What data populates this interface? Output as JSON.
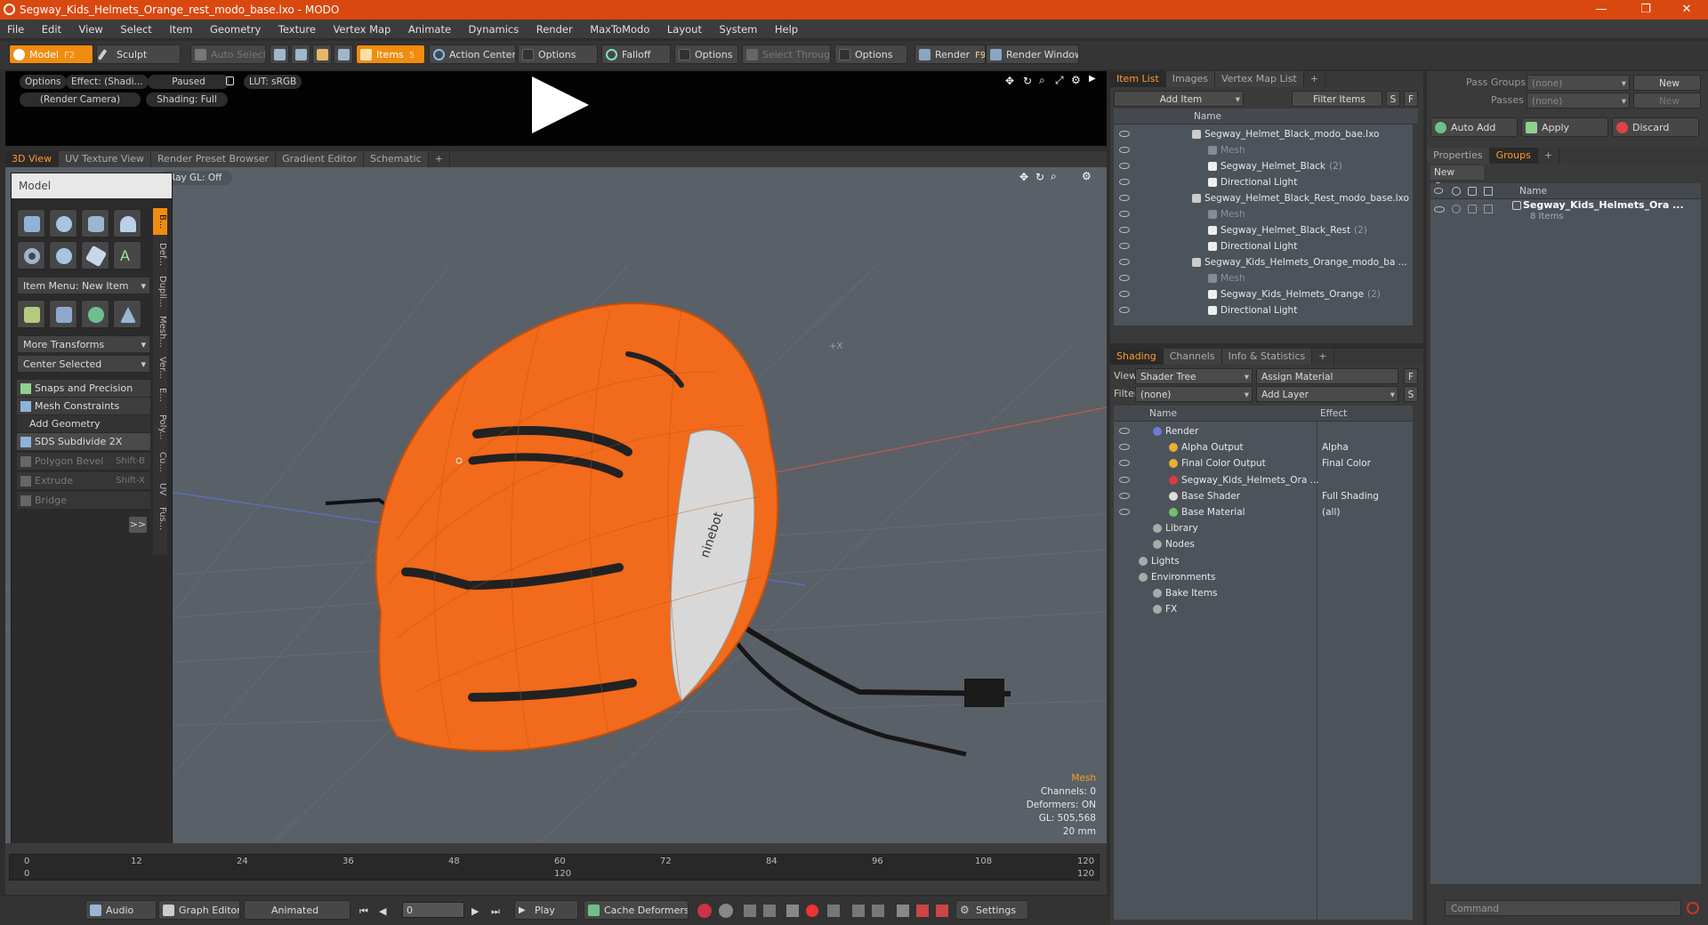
{
  "window": {
    "title": "Segway_Kids_Helmets_Orange_rest_modo_base.lxo - MODO",
    "minimize": "—",
    "maximize": "❐",
    "close": "✕"
  },
  "menu": [
    "File",
    "Edit",
    "View",
    "Select",
    "Item",
    "Geometry",
    "Texture",
    "Vertex Map",
    "Animate",
    "Dynamics",
    "Render",
    "MaxToModo",
    "Layout",
    "System",
    "Help"
  ],
  "toolbar": {
    "model": "Model",
    "model_key": "F2",
    "sculpt": "Sculpt",
    "auto_select": "Auto Select",
    "items": "Items",
    "items_key": "5",
    "action_center": "Action Center",
    "options1": "Options",
    "falloff": "Falloff",
    "options2": "Options",
    "select_through": "Select Through",
    "options3": "Options",
    "render": "Render",
    "render_key": "F9",
    "render_window": "Render Window"
  },
  "preview": {
    "options": "Options",
    "effect": "Effect: (Shadi...",
    "paused": "Paused",
    "lut": "LUT: sRGB",
    "camera": "(Render Camera)",
    "shading": "Shading: Full"
  },
  "view_tabs": [
    "3D View",
    "UV Texture View",
    "Render Preset Browser",
    "Gradient Editor",
    "Schematic",
    "+"
  ],
  "viewport": {
    "raygl": "Ray GL: Off",
    "axis_label": "+X",
    "stats": {
      "mode": "Mesh",
      "channels": "Channels: 0",
      "deformers": "Deformers: ON",
      "gl": "GL: 505,568",
      "scale": "20 mm"
    }
  },
  "toolpanel": {
    "title": "Model",
    "item_menu": "Item Menu: New Item",
    "more_transforms": "More Transforms",
    "center_selected": "Center Selected",
    "snaps": "Snaps and Precision",
    "mesh_constraints": "Mesh Constraints",
    "add_geometry": "Add Geometry",
    "sds": "SDS Subdivide 2X",
    "polygon_bevel": "Polygon Bevel",
    "polygon_bevel_key": "Shift-B",
    "extrude": "Extrude",
    "extrude_key": "Shift-X",
    "bridge": "Bridge",
    "more": ">>",
    "vtabs": [
      "B...",
      "Def...",
      "Dupli...",
      "Mesh...",
      "Ver...",
      "E...",
      "Poly...",
      "Cu...",
      "UV",
      "Fus..."
    ]
  },
  "timeline": {
    "ticks": [
      "0",
      "12",
      "24",
      "36",
      "48",
      "60",
      "72",
      "84",
      "96",
      "108",
      "120"
    ],
    "sub": [
      "0",
      "120",
      "120"
    ]
  },
  "transport": {
    "audio": "Audio",
    "graph_editor": "Graph Editor",
    "animated": "Animated",
    "frame": "0",
    "play": "Play",
    "cache": "Cache Deformers",
    "settings": "Settings"
  },
  "item_list": {
    "tabs": [
      "Item List",
      "Images",
      "Vertex Map List",
      "+"
    ],
    "add_item": "Add Item",
    "filter": "Filter Items",
    "s": "S",
    "f": "F",
    "col_name": "Name",
    "rows": [
      {
        "label": "Segway_Helmet_Black_modo_bae.lxo",
        "count": "",
        "dim": false
      },
      {
        "label": "Mesh",
        "count": "",
        "dim": true
      },
      {
        "label": "Segway_Helmet_Black",
        "count": "(2)",
        "dim": false
      },
      {
        "label": "Directional Light",
        "count": "",
        "dim": false
      },
      {
        "label": "Segway_Helmet_Black_Rest_modo_base.lxo",
        "count": "",
        "dim": false
      },
      {
        "label": "Mesh",
        "count": "",
        "dim": true
      },
      {
        "label": "Segway_Helmet_Black_Rest",
        "count": "(2)",
        "dim": false
      },
      {
        "label": "Directional Light",
        "count": "",
        "dim": false
      },
      {
        "label": "Segway_Kids_Helmets_Orange_modo_ba ...",
        "count": "",
        "dim": false
      },
      {
        "label": "Mesh",
        "count": "",
        "dim": true
      },
      {
        "label": "Segway_Kids_Helmets_Orange",
        "count": "(2)",
        "dim": false
      },
      {
        "label": "Directional Light",
        "count": "",
        "dim": false
      }
    ]
  },
  "shading": {
    "tabs": [
      "Shading",
      "Channels",
      "Info & Statistics",
      "+"
    ],
    "view_label": "View",
    "view_value": "Shader Tree",
    "assign": "Assign Material",
    "filter_label": "Filter",
    "filter_value": "(none)",
    "add_layer": "Add Layer",
    "f": "F",
    "s": "S",
    "col_name": "Name",
    "col_effect": "Effect",
    "rows": [
      {
        "label": "Render",
        "effect": ""
      },
      {
        "label": "Alpha Output",
        "effect": "Alpha"
      },
      {
        "label": "Final Color Output",
        "effect": "Final Color"
      },
      {
        "label": "Segway_Kids_Helmets_Ora ...",
        "effect": ""
      },
      {
        "label": "Base Shader",
        "effect": "Full Shading"
      },
      {
        "label": "Base Material",
        "effect": "(all)"
      },
      {
        "label": "Library",
        "effect": ""
      },
      {
        "label": "Nodes",
        "effect": ""
      },
      {
        "label": "Lights",
        "effect": ""
      },
      {
        "label": "Environments",
        "effect": ""
      },
      {
        "label": "Bake Items",
        "effect": ""
      },
      {
        "label": "FX",
        "effect": ""
      }
    ]
  },
  "far_right": {
    "pass_groups": "Pass Groups",
    "passes": "Passes",
    "none1": "(none)",
    "none2": "(none)",
    "new1": "New",
    "new2": "New",
    "auto_add": "Auto Add",
    "apply": "Apply",
    "discard": "Discard",
    "tabs": [
      "Properties",
      "Groups",
      "+"
    ],
    "new_group": "New Group",
    "col_name": "Name",
    "group_name": "Segway_Kids_Helmets_Ora ...",
    "group_count": "8 Items",
    "command": "Command"
  },
  "colors": {
    "accent": "#f08c10",
    "title": "#d9480f",
    "helmet": "#f26a1b"
  }
}
